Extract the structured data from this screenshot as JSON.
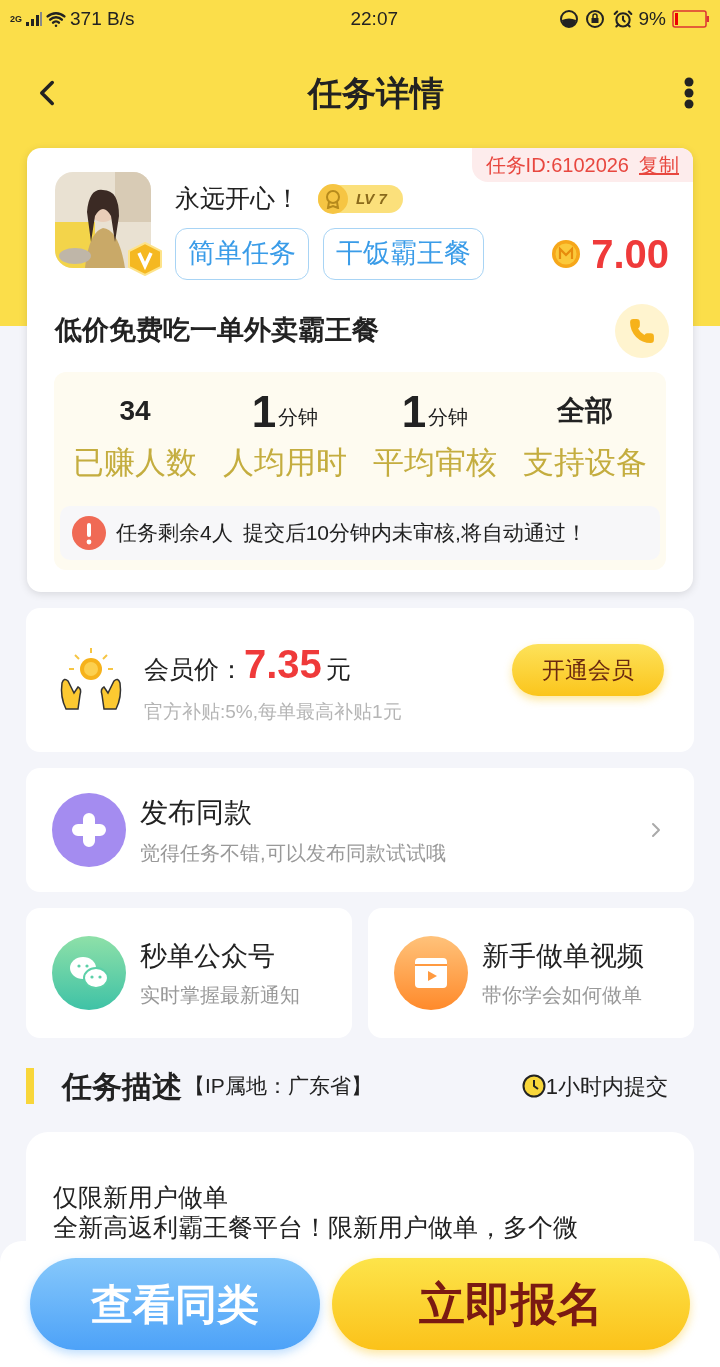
{
  "status_bar": {
    "network": "2G",
    "speed": "371 B/s",
    "time": "22:07",
    "battery": "9%"
  },
  "header": {
    "title": "任务详情"
  },
  "task": {
    "id_label": "任务ID:6102026",
    "copy": "复制",
    "user_name": "永远开心！",
    "level": "LV 7",
    "tags": [
      "简单任务",
      "干饭霸王餐"
    ],
    "reward": "7.00",
    "title": "低价免费吃一单外卖霸王餐",
    "stats": [
      {
        "value": "34",
        "label": "已赚人数"
      },
      {
        "value": "1",
        "unit": "分钟",
        "label": "人均用时"
      },
      {
        "value": "1",
        "unit": "分钟",
        "label": "平均审核"
      },
      {
        "value": "全部",
        "label": "支持设备"
      }
    ],
    "notice": [
      "任务剩余4人",
      "提交后10分钟内未审核,将自动通过！"
    ]
  },
  "member": {
    "label": "会员价：",
    "price": "7.35",
    "unit": "元",
    "note": "官方补贴:5%,每单最高补贴1元",
    "button": "开通会员"
  },
  "publish": {
    "title": "发布同款",
    "subtitle": "觉得任务不错,可以发布同款试试哦"
  },
  "shortcuts": [
    {
      "kind": "wechat",
      "title": "秒单公众号",
      "subtitle": "实时掌握最新通知"
    },
    {
      "kind": "video",
      "title": "新手做单视频",
      "subtitle": "带你学会如何做单"
    }
  ],
  "description_header": {
    "title": "任务描述",
    "ip": "【IP属地：广东省】",
    "deadline": "1小时内提交"
  },
  "description": {
    "lines": [
      "仅限新用户做单",
      "全新高返利霸王餐平台！限新用户做单，多个微"
    ]
  },
  "actions": [
    {
      "kind": "secondary",
      "label": "查看同类"
    },
    {
      "kind": "primary",
      "label": "立即报名"
    }
  ]
}
